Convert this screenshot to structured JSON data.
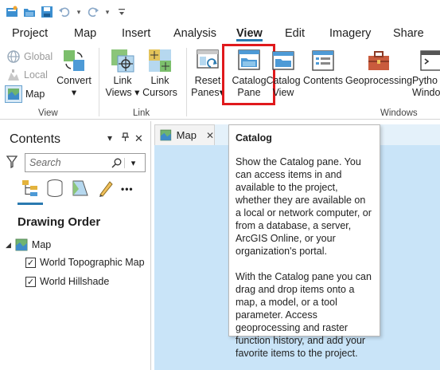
{
  "ribbon_tabs": [
    "Project",
    "Map",
    "Insert",
    "Analysis",
    "View",
    "Edit",
    "Imagery",
    "Share"
  ],
  "active_tab": "View",
  "ribbon": {
    "view_group": {
      "global_label": "Global",
      "local_label": "Local",
      "map_label": "Map",
      "convert_label": "Convert",
      "group_label": "View"
    },
    "link_group": {
      "link_views_line1": "Link",
      "link_views_line2": "Views",
      "link_cursors_line1": "Link",
      "link_cursors_line2": "Cursors",
      "group_label": "Link"
    },
    "windows_group": {
      "reset_panes_line1": "Reset",
      "reset_panes_line2": "Panes",
      "catalog_pane_line1": "Catalog",
      "catalog_pane_line2": "Pane",
      "catalog_view_line1": "Catalog",
      "catalog_view_line2": "View",
      "contents_label": "Contents",
      "geoprocessing_label": "Geoprocessing",
      "python_line1": "Pytho",
      "python_line2": "Window",
      "group_label": "Windows"
    }
  },
  "contents_pane": {
    "title": "Contents",
    "search_placeholder": "Search",
    "drawing_order": "Drawing Order",
    "map_node": "Map",
    "layers": [
      "World Topographic Map",
      "World Hillshade"
    ]
  },
  "map_tab": {
    "label": "Map"
  },
  "tooltip": {
    "title": "Catalog",
    "paragraph1": "Show the Catalog pane. You can access items in and available to the project, whether they are available on a local or network computer, or from a database, a server, ArcGIS Online, or your organization's portal.",
    "paragraph2": "With the Catalog pane you can drag and drop items onto a map, a model, or a tool parameter. Access geoprocessing and raster function history, and add your favorite items to the project."
  },
  "colors": {
    "accent": "#2a7ab0",
    "highlight": "#e0191c",
    "map_background": "#c9e4f8"
  },
  "glyphs": {
    "dropdown": "▾",
    "close": "✕",
    "pin": "📌",
    "more": "•••",
    "collapse": "◢",
    "check": "✓"
  }
}
